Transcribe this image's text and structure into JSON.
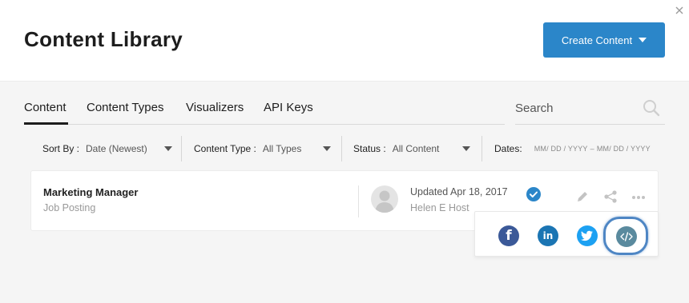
{
  "header": {
    "title": "Content Library",
    "create_button_label": "Create Content"
  },
  "tabs": [
    {
      "label": "Content",
      "active": true
    },
    {
      "label": "Content Types",
      "active": false
    },
    {
      "label": "Visualizers",
      "active": false
    },
    {
      "label": "API Keys",
      "active": false
    }
  ],
  "search": {
    "placeholder": "Search"
  },
  "filters": {
    "sort_by": {
      "label": "Sort By :",
      "value": "Date (Newest)"
    },
    "content_type": {
      "label": "Content Type :",
      "value": "All Types"
    },
    "status": {
      "label": "Status :",
      "value": "All Content"
    },
    "dates": {
      "label": "Dates:",
      "from_placeholder": "MM/ DD / YYYY",
      "separator": "–",
      "to_placeholder": "MM/ DD / YYYY"
    }
  },
  "items": [
    {
      "title": "Marketing Manager",
      "type": "Job Posting",
      "updated": "Updated Apr 18, 2017",
      "author": "Helen E Host",
      "status_icon": "check-circle-icon"
    }
  ],
  "share_menu": {
    "options": [
      "facebook-icon",
      "linkedin-icon",
      "twitter-icon",
      "embed-code-icon"
    ],
    "highlighted": "embed-code-icon"
  },
  "colors": {
    "accent": "#2b86c9",
    "facebook": "#3b5998",
    "linkedin": "#1b75b3",
    "twitter": "#1da1f2",
    "embed": "#5a8a9e",
    "highlight_ring": "#4e86c4"
  }
}
